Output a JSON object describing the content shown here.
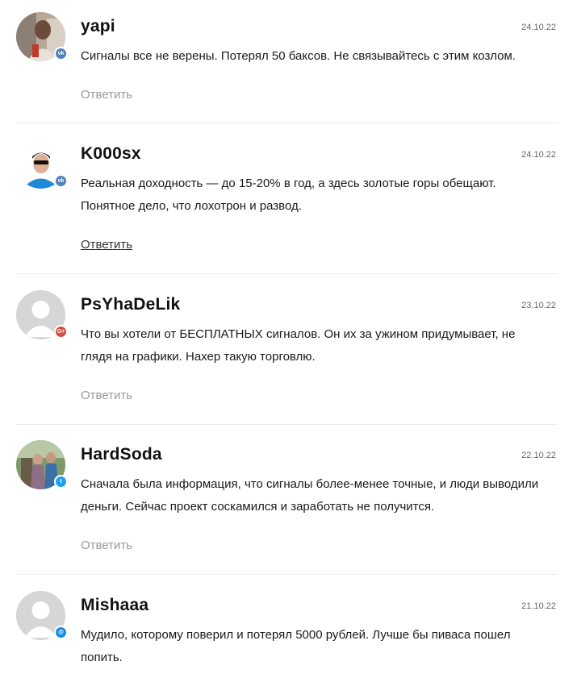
{
  "comments": [
    {
      "author": "yapi",
      "date": "24.10.22",
      "text": "Сигналы все не верены. Потерял 50 баксов. Не связывайтесь с этим козлом.",
      "reply_label": "Ответить",
      "social": "vk-icon",
      "badge_color": "#5181b8",
      "badge_text": "vk"
    },
    {
      "author": "K000sx",
      "date": "24.10.22",
      "text": "Реальная доходность — до 15-20% в год, а здесь золотые горы обещают. Понятное дело, что лохотрон и развод.",
      "reply_label": "Ответить",
      "social": "vk-icon",
      "badge_color": "#5181b8",
      "badge_text": "vk"
    },
    {
      "author": "PsYhaDeLik",
      "date": "23.10.22",
      "text": "Что вы хотели от БЕСПЛАТНЫХ сигналов. Он их за ужином придумывает, не глядя на графики. Нахер такую торговлю.",
      "reply_label": "Ответить",
      "social": "google-plus-icon",
      "badge_color": "#dc4e41",
      "badge_text": "G+"
    },
    {
      "author": "HardSoda",
      "date": "22.10.22",
      "text": "Сначала была информация, что сигналы более-менее точные, и люди выводили деньги. Сейчас проект соскамился и заработать не получится.",
      "reply_label": "Ответить",
      "social": "twitter-icon",
      "badge_color": "#1da1f2",
      "badge_text": "t"
    },
    {
      "author": "Mishaaa",
      "date": "21.10.22",
      "text": "Мудило, которому поверил и потерял 5000 рублей. Лучше бы пиваса пошел попить.",
      "reply_label": "Ответить",
      "social": "mail-icon",
      "badge_color": "#168de2",
      "badge_text": "@"
    }
  ]
}
